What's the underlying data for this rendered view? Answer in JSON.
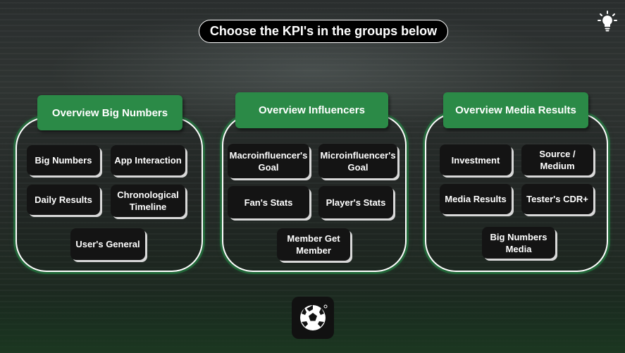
{
  "header": {
    "title": "Choose the KPI's in the groups below"
  },
  "groups": [
    {
      "title": "Overview Big Numbers",
      "kpis": [
        "Big Numbers",
        "App Interaction",
        "Daily Results",
        "Chronological Timeline",
        "User's General"
      ]
    },
    {
      "title": "Overview Influencers",
      "kpis": [
        "Macroinfluencer's Goal",
        "Microinfluencer's Goal",
        "Fan's Stats",
        "Player's Stats",
        "Member Get Member"
      ]
    },
    {
      "title": "Overview Media Results",
      "kpis": [
        "Investment",
        "Source / Medium",
        "Media Results",
        "Tester's CDR+",
        "Big Numbers Media"
      ]
    }
  ],
  "icons": {
    "top_right": "lightbulb-icon",
    "bottom": "soccer-ball-icon"
  },
  "colors": {
    "accent": "#2b8a47",
    "tile": "#141414"
  }
}
